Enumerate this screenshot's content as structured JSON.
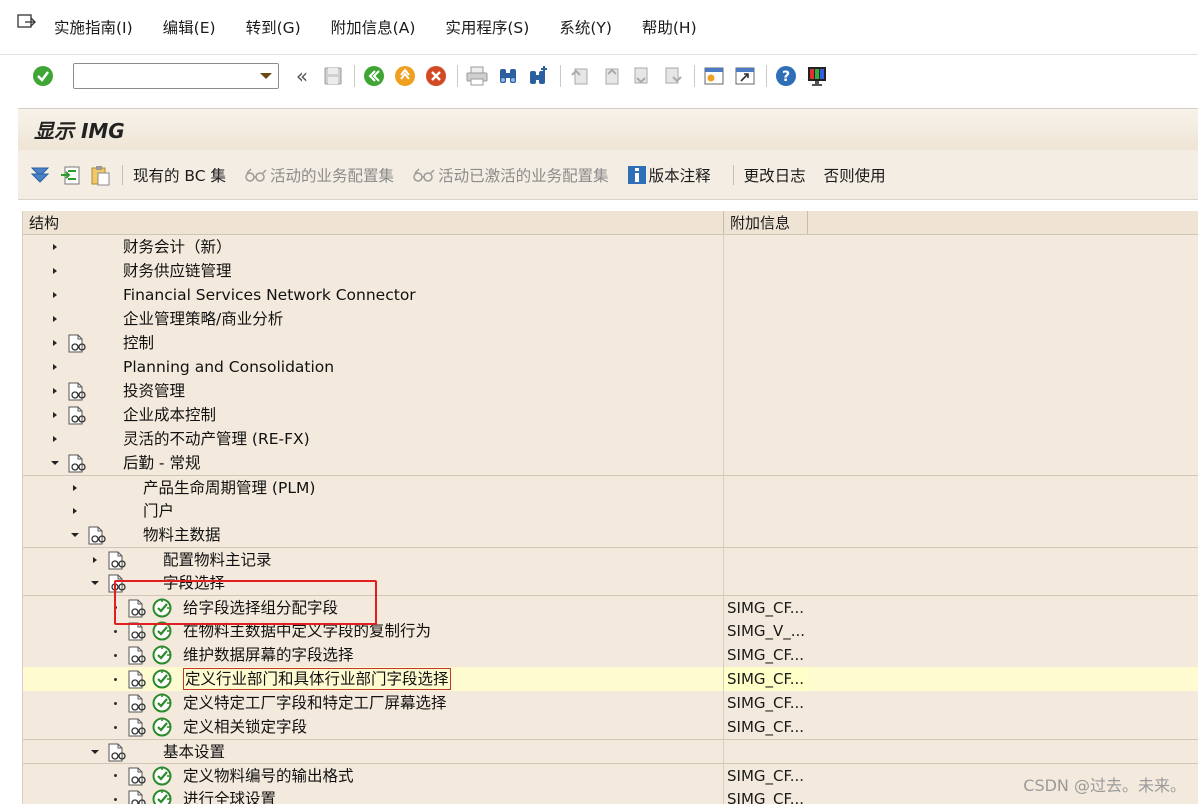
{
  "menubar": {
    "items": [
      "实施指南(I)",
      "编辑(E)",
      "转到(G)",
      "附加信息(A)",
      "实用程序(S)",
      "系统(Y)",
      "帮助(H)"
    ]
  },
  "toolbar": {
    "command_value": ""
  },
  "page": {
    "title": "显示 IMG"
  },
  "app_toolbar": {
    "bc_sets": "现有的 BC 集",
    "active_bc_sets": "活动的业务配置集",
    "activated_bc_sets": "活动已激活的业务配置集",
    "release_notes": "版本注释",
    "change_log": "更改日志",
    "where_used": "否则使用"
  },
  "tree": {
    "header_structure": "结构",
    "header_info": "附加信息",
    "rows": [
      {
        "label": "财务会计（新）",
        "info": ""
      },
      {
        "label": "财务供应链管理",
        "info": ""
      },
      {
        "label": "Financial Services Network Connector",
        "info": ""
      },
      {
        "label": "企业管理策略/商业分析",
        "info": ""
      },
      {
        "label": "控制",
        "info": ""
      },
      {
        "label": "Planning and Consolidation",
        "info": ""
      },
      {
        "label": "投资管理",
        "info": ""
      },
      {
        "label": "企业成本控制",
        "info": ""
      },
      {
        "label": "灵活的不动产管理 (RE-FX)",
        "info": ""
      },
      {
        "label": "后勤 - 常规",
        "info": ""
      },
      {
        "label": "产品生命周期管理 (PLM)",
        "info": ""
      },
      {
        "label": "门户",
        "info": ""
      },
      {
        "label": "物料主数据",
        "info": ""
      },
      {
        "label": "配置物料主记录",
        "info": ""
      },
      {
        "label": "字段选择",
        "info": ""
      },
      {
        "label": "给字段选择组分配字段",
        "info": "SIMG_CF..."
      },
      {
        "label": "在物料主数据中定义字段的复制行为",
        "info": "SIMG_V_..."
      },
      {
        "label": "维护数据屏幕的字段选择",
        "info": "SIMG_CF..."
      },
      {
        "label": "定义行业部门和具体行业部门字段选择",
        "info": "SIMG_CF..."
      },
      {
        "label": "定义特定工厂字段和特定工厂屏幕选择",
        "info": "SIMG_CF..."
      },
      {
        "label": "定义相关锁定字段",
        "info": "SIMG_CF..."
      },
      {
        "label": "基本设置",
        "info": ""
      },
      {
        "label": "定义物料编号的输出格式",
        "info": "SIMG_CF..."
      },
      {
        "label": "进行全球设置",
        "info": "SIMG_CF..."
      }
    ]
  },
  "watermark": "CSDN @过去。未来。"
}
